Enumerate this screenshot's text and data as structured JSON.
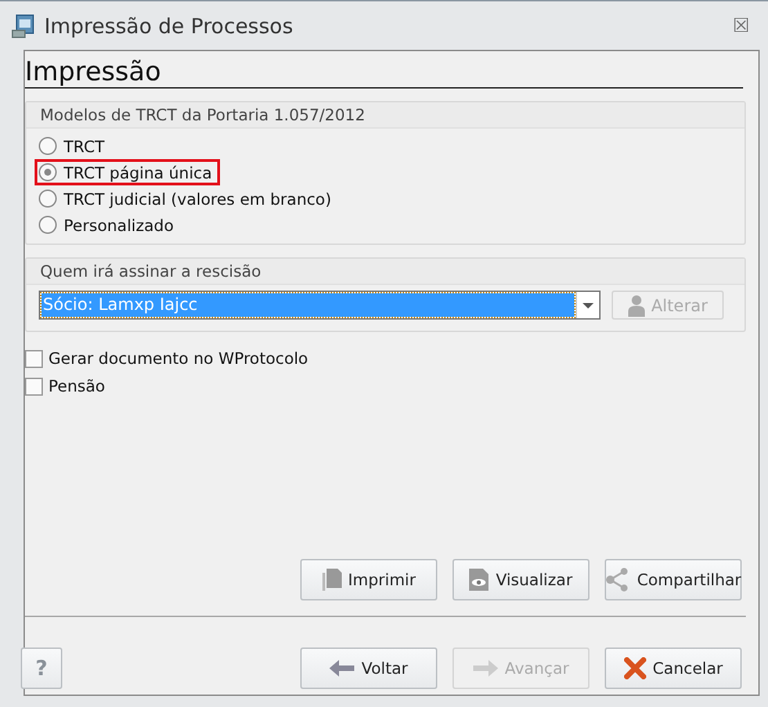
{
  "window": {
    "title": "Impressão de Processos",
    "close": "⮽"
  },
  "heading": "Impressão",
  "models_group": {
    "title": "Modelos de TRCT da Portaria 1.057/2012",
    "options": [
      {
        "label": "TRCT",
        "selected": false,
        "highlighted": false
      },
      {
        "label": "TRCT página única",
        "selected": true,
        "highlighted": true
      },
      {
        "label": "TRCT judicial (valores em branco)",
        "selected": false,
        "highlighted": false
      },
      {
        "label": "Personalizado",
        "selected": false,
        "highlighted": false
      }
    ]
  },
  "signer_group": {
    "title": "Quem irá assinar a rescisão",
    "value": "Sócio: Lamxp Iajcc",
    "change_button": {
      "label": "Alterar",
      "disabled": true
    }
  },
  "checkboxes": [
    {
      "label": "Gerar documento no WProtocolo",
      "checked": false
    },
    {
      "label": "Pensão",
      "checked": false
    }
  ],
  "actions": [
    {
      "kind": "print",
      "label": "Imprimir",
      "disabled": false
    },
    {
      "kind": "preview",
      "label": "Visualizar",
      "disabled": false
    },
    {
      "kind": "share",
      "label": "Compartilhar",
      "disabled": false
    }
  ],
  "help_button": "?",
  "nav": [
    {
      "kind": "back",
      "label": "Voltar",
      "disabled": false
    },
    {
      "kind": "next",
      "label": "Avançar",
      "disabled": true
    },
    {
      "kind": "cancel",
      "label": "Cancelar",
      "disabled": false
    }
  ]
}
